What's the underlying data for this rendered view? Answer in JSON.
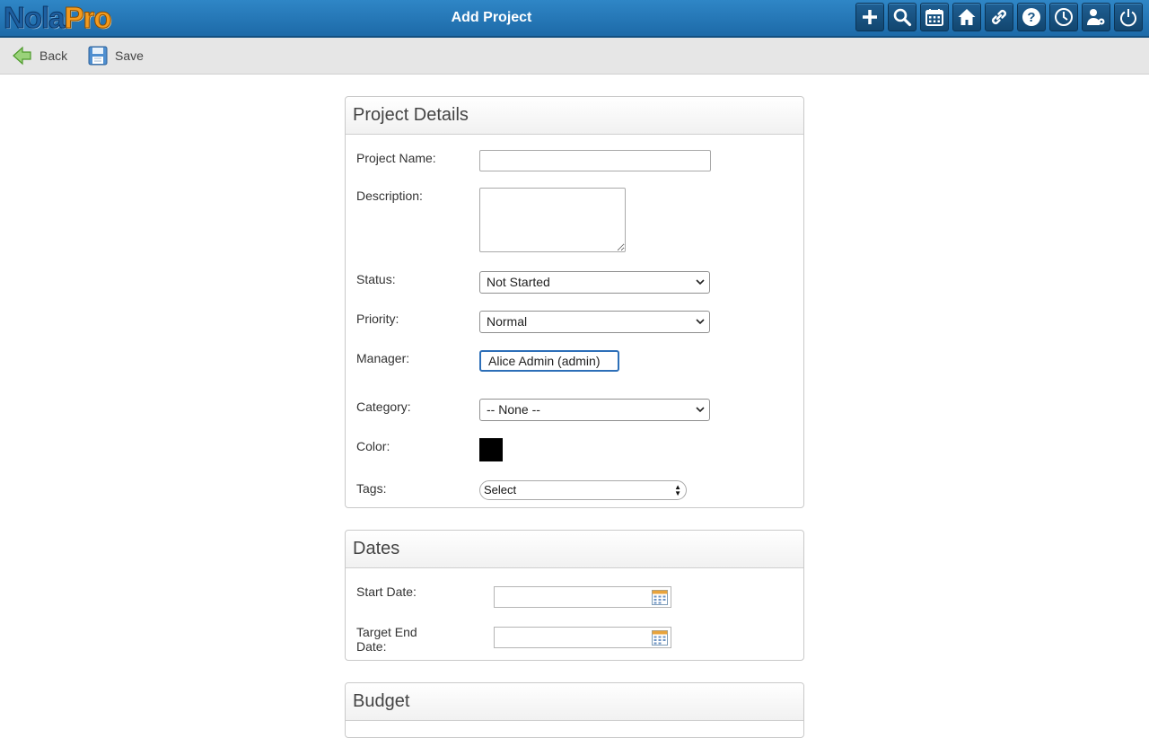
{
  "header": {
    "logo_nola": "Nola",
    "logo_pro": "Pro",
    "title": "Add Project",
    "icons": [
      "plus-icon",
      "search-icon",
      "calendar-icon",
      "home-icon",
      "link-icon",
      "help-icon",
      "clock-icon",
      "user-settings-icon",
      "power-icon"
    ]
  },
  "actions": {
    "back_label": "Back",
    "save_label": "Save"
  },
  "project_details": {
    "title": "Project Details",
    "name_label": "Project Name:",
    "name_value": "",
    "description_label": "Description:",
    "description_value": "",
    "status_label": "Status:",
    "status_value": "Not Started",
    "priority_label": "Priority:",
    "priority_value": "Normal",
    "manager_label": "Manager:",
    "manager_value": "Alice Admin (admin)",
    "category_label": "Category:",
    "category_value": "-- None --",
    "color_label": "Color:",
    "color_value": "#000000",
    "tags_label": "Tags:",
    "tags_value": "Select"
  },
  "dates": {
    "title": "Dates",
    "start_label": "Start Date:",
    "start_value": "",
    "end_label_line1": "Target End",
    "end_label_line2": "Date:",
    "end_value": ""
  },
  "budget": {
    "title": "Budget"
  }
}
